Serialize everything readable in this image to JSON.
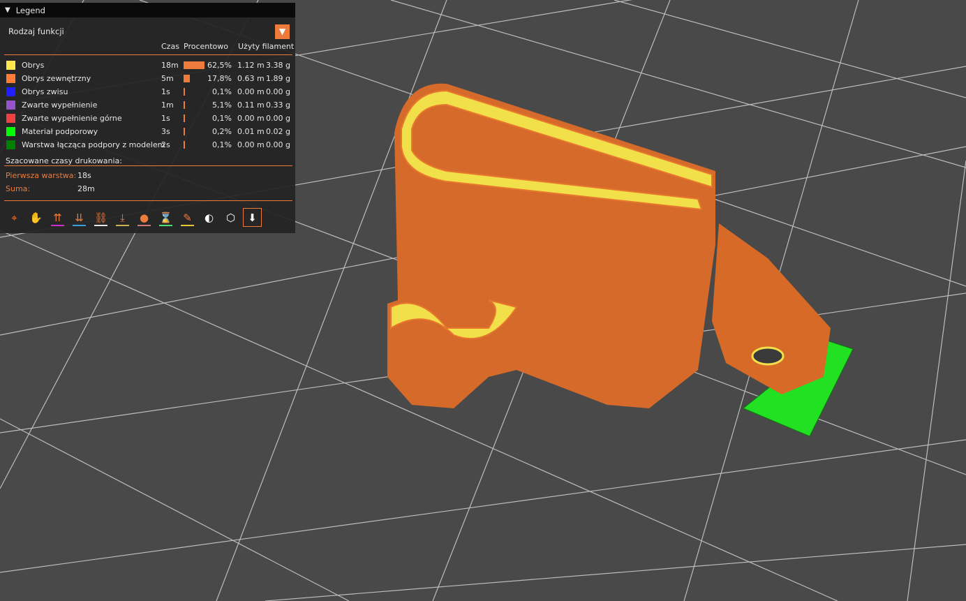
{
  "legend": {
    "title": "Legend",
    "view_type": "Rodzaj funkcji",
    "headers": {
      "time": "Czas",
      "percent": "Procentowo",
      "filament": "Użyty filament"
    },
    "rows": [
      {
        "name": "Obrys",
        "color": "#ffe64d",
        "time": "18m",
        "percent_value": 62.5,
        "percent": "62,5%",
        "length": "1.12 m",
        "weight": "3.38 g"
      },
      {
        "name": "Obrys zewnętrzny",
        "color": "#ff7d38",
        "time": "5m",
        "percent_value": 17.8,
        "percent": "17,8%",
        "length": "0.63 m",
        "weight": "1.89 g"
      },
      {
        "name": "Obrys zwisu",
        "color": "#1f1fff",
        "time": "1s",
        "percent_value": 0.1,
        "percent": "0,1%",
        "length": "0.00 m",
        "weight": "0.00 g"
      },
      {
        "name": "Zwarte wypełnienie",
        "color": "#9654cc",
        "time": "1m",
        "percent_value": 5.1,
        "percent": "5,1%",
        "length": "0.11 m",
        "weight": "0.33 g"
      },
      {
        "name": "Zwarte wypełnienie górne",
        "color": "#f04040",
        "time": "1s",
        "percent_value": 0.1,
        "percent": "0,1%",
        "length": "0.00 m",
        "weight": "0.00 g"
      },
      {
        "name": "Materiał podporowy",
        "color": "#00ff00",
        "time": "3s",
        "percent_value": 0.2,
        "percent": "0,2%",
        "length": "0.01 m",
        "weight": "0.02 g"
      },
      {
        "name": "Warstwa łącząca podpory z modelem",
        "color": "#008000",
        "time": "2s",
        "percent_value": 0.1,
        "percent": "0,1%",
        "length": "0.00 m",
        "weight": "0.00 g"
      }
    ],
    "estimated_title": "Szacowane czasy drukowania:",
    "first_layer_label": "Pierwsza warstwa:",
    "first_layer_value": "18s",
    "total_label": "Suma:",
    "total_value": "28m",
    "accent": "#ed7b3c"
  },
  "toolbar": [
    {
      "icon": "travel-icon",
      "underline": null
    },
    {
      "icon": "wipe-icon",
      "underline": null
    },
    {
      "icon": "retractions-icon",
      "underline": "#d22ad2"
    },
    {
      "icon": "deretractions-icon",
      "underline": "#3ca0dc"
    },
    {
      "icon": "seams-icon",
      "underline": "#e6e6e6"
    },
    {
      "icon": "tool-changes-icon",
      "underline": "#c8b450"
    },
    {
      "icon": "color-changes-icon",
      "underline": "#d27878"
    },
    {
      "icon": "pause-icon",
      "underline": "#50dc78"
    },
    {
      "icon": "custom-gcode-icon",
      "underline": "#e6c832"
    },
    {
      "icon": "center-of-gravity-icon",
      "underline": null
    },
    {
      "icon": "shells-icon",
      "underline": null
    },
    {
      "icon": "tool-marker-icon",
      "underline": null
    }
  ]
}
